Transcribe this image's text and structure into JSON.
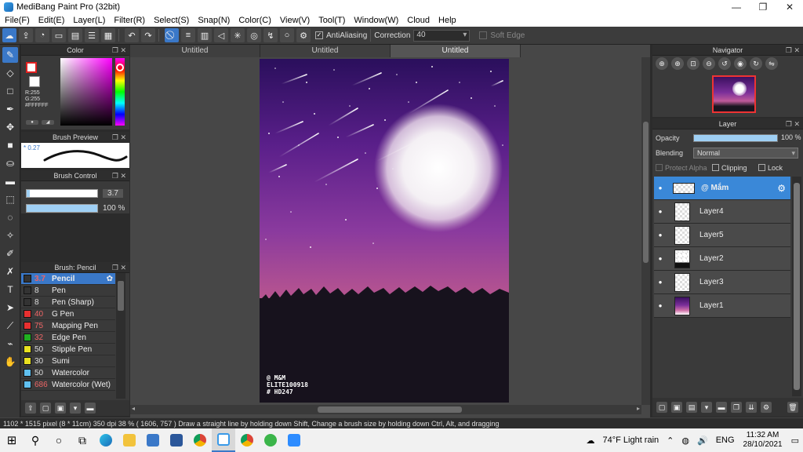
{
  "window": {
    "title": "MediBang Paint Pro (32bit)",
    "controls": [
      "—",
      "❐",
      "✕"
    ]
  },
  "menu": [
    "File(F)",
    "Edit(E)",
    "Layer(L)",
    "Filter(R)",
    "Select(S)",
    "Snap(N)",
    "Color(C)",
    "View(V)",
    "Tool(T)",
    "Window(W)",
    "Cloud",
    "Help"
  ],
  "toolbar": {
    "antialiasing_label": "AntiAliasing",
    "antialiasing_checked": true,
    "correction_label": "Correction",
    "correction_value": "40",
    "soft_edge_label": "Soft Edge",
    "soft_edge_checked": false
  },
  "panels": {
    "color": {
      "title": "Color",
      "fg_color": "#FFFFFF",
      "rgb_lines": [
        "R:255",
        "G:255",
        "#FFFFFF"
      ]
    },
    "brush_preview": {
      "title": "Brush Preview",
      "size": "0.27"
    },
    "brush_control": {
      "title": "Brush Control",
      "size_value": "3.7",
      "opacity_value": "100 %",
      "opacity_fraction": 1.0
    },
    "brush_list": {
      "title": "Brush: Pencil",
      "items": [
        {
          "size": "3.7",
          "name": "Pencil",
          "color": "#333333",
          "active": true
        },
        {
          "size": "8",
          "name": "Pen",
          "color": "#333333"
        },
        {
          "size": "8",
          "name": "Pen (Sharp)",
          "color": "#333333"
        },
        {
          "size": "40",
          "name": "G Pen",
          "color": "#e83030"
        },
        {
          "size": "75",
          "name": "Mapping Pen",
          "color": "#e83030"
        },
        {
          "size": "32",
          "name": "Edge Pen",
          "color": "#20b020"
        },
        {
          "size": "50",
          "name": "Stipple Pen",
          "color": "#e8e020"
        },
        {
          "size": "30",
          "name": "Sumi",
          "color": "#e8e020"
        },
        {
          "size": "50",
          "name": "Watercolor",
          "color": "#60c0f0"
        },
        {
          "size": "686",
          "name": "Watercolor (Wet)",
          "color": "#60c0f0"
        }
      ]
    },
    "navigator": {
      "title": "Navigator"
    },
    "layer": {
      "title": "Layer",
      "opacity_label": "Opacity",
      "opacity_value": "100 %",
      "blending_label": "Blending",
      "blending_value": "Normal",
      "protect_alpha_label": "Protect Alpha",
      "clipping_label": "Clipping",
      "lock_label": "Lock",
      "layers": [
        {
          "name": "@ Mắm",
          "active": true,
          "thumb": "checker"
        },
        {
          "name": "Layer4",
          "thumb": "checker"
        },
        {
          "name": "Layer5",
          "thumb": "checker"
        },
        {
          "name": "Layer2",
          "thumb": "dark"
        },
        {
          "name": "Layer3",
          "thumb": "checker"
        },
        {
          "name": "Layer1",
          "thumb": "art"
        }
      ]
    }
  },
  "tabs": [
    {
      "label": "Untitled",
      "active": false
    },
    {
      "label": "Untitled",
      "active": false
    },
    {
      "label": "Untitled",
      "active": true
    }
  ],
  "artwork": {
    "signature_lines": [
      "@ M&M",
      "ELITE100918",
      "# HD247"
    ]
  },
  "status": {
    "text": "1102 * 1515 pixel   (8 * 11cm)   350 dpi   38 %   ( 1606, 757 )   Draw a straight line by holding down Shift, Change a brush size by holding down Ctrl, Alt, and dragging"
  },
  "taskbar": {
    "weather": "74°F  Light rain",
    "lang": "ENG",
    "time": "11:32 AM",
    "date": "28/10/2021"
  },
  "colors": {
    "accent": "#3a78c8",
    "sky_top": "#2a0f5c",
    "sky_mid": "#7b2f9a",
    "horizon": "#c8608f"
  }
}
